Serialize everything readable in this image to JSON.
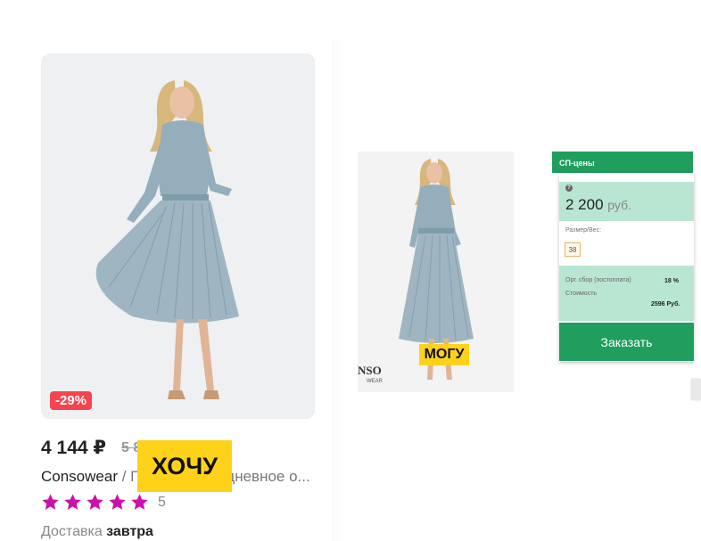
{
  "product": {
    "discount": "-29%",
    "price": "4 144 ₽",
    "old_price": "5 8",
    "brand": "Consowear",
    "title_rest": " / Платье повседневное о...",
    "rating_count": "5",
    "delivery_label": "Доставка",
    "delivery_value": "завтра"
  },
  "badges": {
    "want": "ХОЧУ",
    "can": "МОГУ"
  },
  "second_image": {
    "logo_text": "NSO",
    "logo_sub": "WEAR"
  },
  "sp_panel": {
    "tab_label": "СП-цены",
    "help_icon": "?",
    "price": "2 200",
    "price_unit": "руб.",
    "size_label": "Размер/Вес:",
    "size_value": "38",
    "fee_label": "Орг. сбор (постоплата)",
    "fee_value": "18 %",
    "cost_label": "Стоимость",
    "cost_value": "2596 Руб.",
    "order_button": "Заказать"
  },
  "colors": {
    "accent_green": "#1f9e5e",
    "panel_mint": "#b9e6d2",
    "discount_red": "#f4454f",
    "badge_yellow": "#ffd21a",
    "star_magenta": "#cc11aa"
  },
  "icons": {
    "rating": "star-icon",
    "help": "question-icon"
  },
  "rating_stars": 5
}
